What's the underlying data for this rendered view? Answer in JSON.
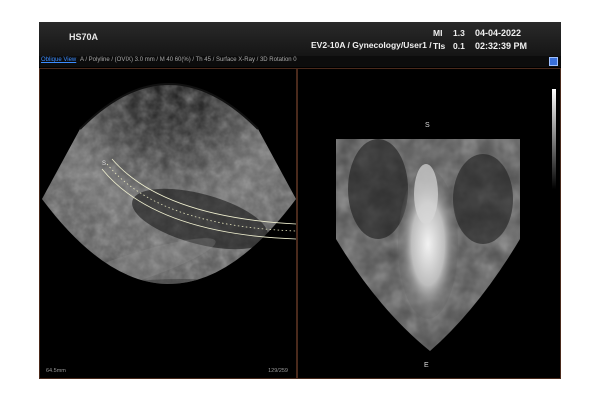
{
  "header": {
    "device_name": "HS70A",
    "probe_info": "EV2-10A / Gynecology/User1 /",
    "mi_label": "MI",
    "mi_value": "1.3",
    "tis_label": "TIs",
    "tis_value": "0.1",
    "date": "04-04-2022",
    "time": "02:32:39 PM"
  },
  "info_bar": {
    "oblique_view_link": "Oblique View",
    "params": "A / Polyline / (OVIX) 3.0 mm / M 40 60(%) / Th 45 / Surface X-Ray / 3D Rotation 0"
  },
  "left_view": {
    "depth": "64.5mm",
    "frame_count": "129/259"
  },
  "right_view": {
    "start_marker": "S",
    "end_marker": "E"
  },
  "colors": {
    "background": "#000000",
    "link": "#3b8cff",
    "overlay_line": "#f0f0d0",
    "accent": "#3a6fd8"
  }
}
